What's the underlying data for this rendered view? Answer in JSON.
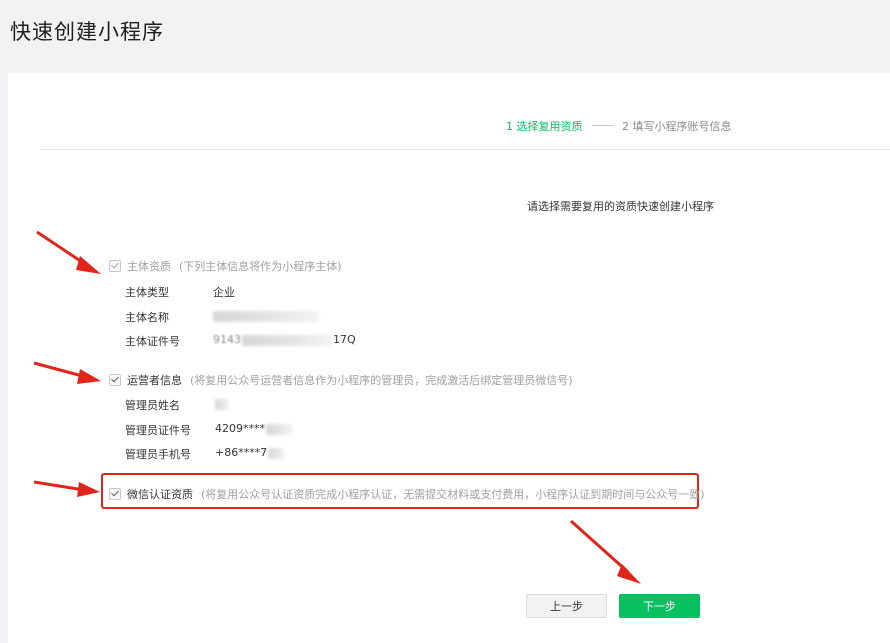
{
  "page": {
    "title": "快速创建小程序"
  },
  "steps": {
    "step1": "1 选择复用资质",
    "step2": "2 填写小程序账号信息"
  },
  "intro": "请选择需要复用的资质快速创建小程序",
  "subject_section": {
    "label": "主体资质",
    "note": "(下列主体信息将作为小程序主体)",
    "checked": true,
    "fields": [
      {
        "label": "主体类型",
        "value": "企业"
      },
      {
        "label": "主体名称",
        "value": ""
      },
      {
        "label": "主体证件号",
        "value_prefix": "9143",
        "value_suffix": "17Q"
      }
    ]
  },
  "operator_section": {
    "label": "运营者信息",
    "note": "(将复用公众号运营者信息作为小程序的管理员，完成激活后绑定管理员微信号)",
    "checked": true,
    "fields": [
      {
        "label": "管理员姓名",
        "value": ""
      },
      {
        "label": "管理员证件号",
        "value": "4209****"
      },
      {
        "label": "管理员手机号",
        "value": "+86****7"
      }
    ]
  },
  "wechat_section": {
    "label": "微信认证资质",
    "note": "(将复用公众号认证资质完成小程序认证，无需提交材料或支付费用，小程序认证到期时间与公众号一致)",
    "checked": true
  },
  "buttons": {
    "prev": "上一步",
    "next": "下一步"
  },
  "colors": {
    "accent": "#07c160",
    "annotation": "#e0251b"
  }
}
